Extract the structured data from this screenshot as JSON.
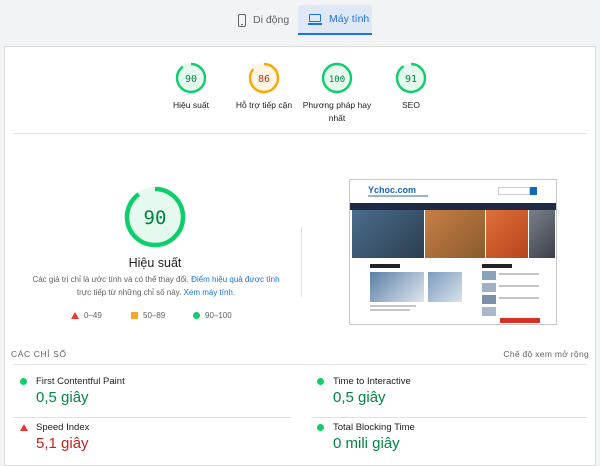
{
  "tabs": {
    "mobile": "Di động",
    "desktop": "Máy tính"
  },
  "summary": [
    {
      "score": 90,
      "label": "Hiệu suất",
      "color": "#0cce6b",
      "status": "pass"
    },
    {
      "score": 86,
      "label": "Hỗ trợ tiếp cận",
      "color": "#ffa400",
      "status": "average"
    },
    {
      "score": 100,
      "label": "Phương pháp hay nhất",
      "color": "#0cce6b",
      "status": "pass"
    },
    {
      "score": 91,
      "label": "SEO",
      "color": "#0cce6b",
      "status": "pass"
    }
  ],
  "performance": {
    "score": 90,
    "title": "Hiệu suất",
    "disclaimer_prefix": "Các giá trị chỉ là ước tính và có thể thay đổi.",
    "disclaimer_link1": "Điểm hiệu quả được tính",
    "disclaimer_middle": "trực tiếp từ những chỉ số này.",
    "disclaimer_link2": "Xem máy tính."
  },
  "legend": {
    "fail": "0–49",
    "average": "50–89",
    "pass": "90–100"
  },
  "screenshot": {
    "logo": "Ychoc.com"
  },
  "metrics_header": {
    "title": "CÁC CHỈ SỐ",
    "expand": "Chế độ xem mở rộng"
  },
  "metrics": [
    {
      "name": "First Contentful Paint",
      "value": "0,5 giây",
      "status": "pass"
    },
    {
      "name": "Time to Interactive",
      "value": "0,5 giây",
      "status": "pass"
    },
    {
      "name": "Speed Index",
      "value": "5,1 giây",
      "status": "fail"
    },
    {
      "name": "Total Blocking Time",
      "value": "0 mili giây",
      "status": "pass"
    }
  ],
  "colors": {
    "pass": "#0cce6b",
    "average": "#ffa400",
    "fail": "#e53935",
    "accent": "#1a73e8"
  }
}
